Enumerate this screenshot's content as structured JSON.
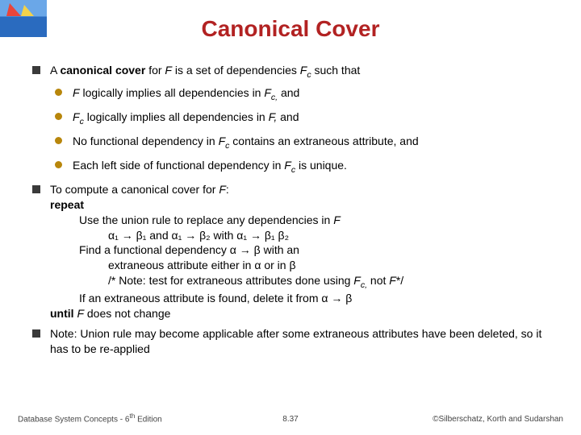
{
  "title": "Canonical Cover",
  "bullets": {
    "b1_pre": "A ",
    "b1_bold": "canonical cover ",
    "b1_post1": "for ",
    "b1_var1": "F",
    "b1_post2": " is a set of dependencies ",
    "b1_var2": "F",
    "b1_sub1": "c",
    "b1_post3": " such that",
    "b1a_var1": "F",
    "b1a_text1": " logically implies all dependencies in ",
    "b1a_var2": "F",
    "b1a_sub1": "c,",
    "b1a_text2": " and",
    "b1b_var1": "F",
    "b1b_sub1": "c",
    "b1b_text1": " logically implies all dependencies in ",
    "b1b_var2": "F,",
    "b1b_text2": " and",
    "b1c_text1": "No functional dependency in ",
    "b1c_var1": "F",
    "b1c_sub1": "c",
    "b1c_text2": " contains an extraneous attribute, and",
    "b1d_text1": "Each left side of functional dependency in ",
    "b1d_var1": "F",
    "b1d_sub1": "c",
    "b1d_text2": " is unique.",
    "b2_line1a": "To compute a canonical cover for ",
    "b2_line1var": "F",
    "b2_line1b": ":",
    "b2_repeat": "repeat",
    "b2_l3a": "Use the union rule to replace any dependencies in ",
    "b2_l3var": "F",
    "b2_l4": "α₁ → β₁ and α₁ → β₂ with α₁ → β₁ β₂",
    "b2_l5": "Find a functional dependency α → β with an",
    "b2_l6": "extraneous attribute either in α or in β",
    "b2_l7a": "/* Note: test for extraneous attributes done using ",
    "b2_l7var1": "F",
    "b2_l7sub1": "c,",
    "b2_l7b": " not ",
    "b2_l7var2": "F",
    "b2_l7c": "*/",
    "b2_l8": "If an extraneous attribute is found, delete it from α → β",
    "b2_until_a": "until ",
    "b2_until_var": "F",
    "b2_until_b": " does not change",
    "b3": "Note: Union rule may become applicable after some extraneous attributes have been deleted, so it has to be re-applied"
  },
  "footer": {
    "left_a": "Database System Concepts - 6",
    "left_sup": "th",
    "left_b": " Edition",
    "mid": "8.37",
    "right": "©Silberschatz, Korth and Sudarshan"
  }
}
